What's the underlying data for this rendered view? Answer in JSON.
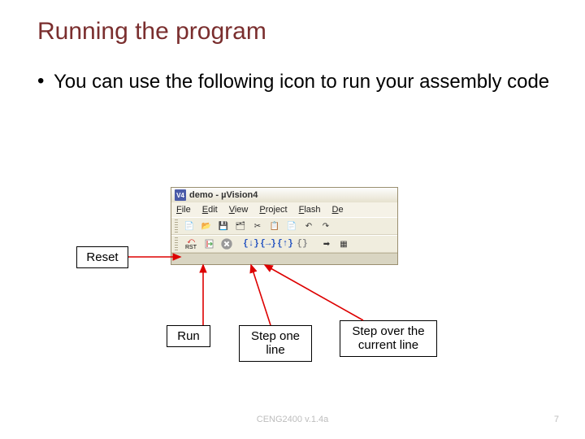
{
  "title": "Running the program",
  "bullet": {
    "marker": "•",
    "text": "You can use the following icon to run your assembly code"
  },
  "app": {
    "icon_text": "V4",
    "title": "demo  -  µVision4",
    "menus": [
      "File",
      "Edit",
      "View",
      "Project",
      "Flash",
      "De"
    ],
    "rst_label": "RST"
  },
  "callouts": {
    "reset": "Reset",
    "run": "Run",
    "step_one": "Step one line",
    "step_over": "Step over the current line"
  },
  "footer": {
    "center": "CENG2400 v.1.4a",
    "page": "7"
  }
}
